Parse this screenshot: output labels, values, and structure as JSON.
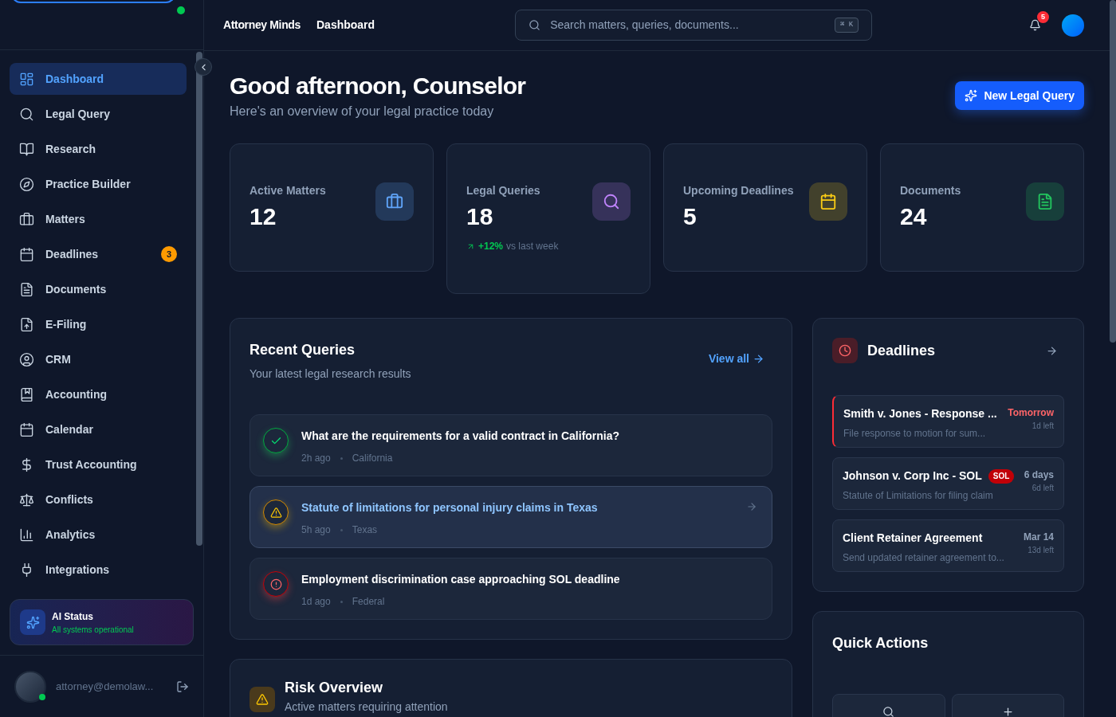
{
  "sidebar": {
    "status_online": true,
    "nav": [
      {
        "label": "Dashboard",
        "selected": true
      },
      {
        "label": "Legal Query",
        "selected": false
      },
      {
        "label": "Research",
        "selected": false
      },
      {
        "label": "Practice Builder",
        "selected": false
      },
      {
        "label": "Matters",
        "selected": false
      },
      {
        "label": "Deadlines",
        "selected": false,
        "badge": "3"
      },
      {
        "label": "Documents",
        "selected": false
      },
      {
        "label": "E-Filing",
        "selected": false
      },
      {
        "label": "CRM",
        "selected": false
      },
      {
        "label": "Accounting",
        "selected": false
      },
      {
        "label": "Calendar",
        "selected": false
      },
      {
        "label": "Trust Accounting",
        "selected": false
      },
      {
        "label": "Conflicts",
        "selected": false
      },
      {
        "label": "Analytics",
        "selected": false
      },
      {
        "label": "Integrations",
        "selected": false
      }
    ],
    "ai_status": {
      "title": "AI Status",
      "text": "All systems operational"
    },
    "user": {
      "email": "attorney@demolaw...",
      "online": true
    }
  },
  "header": {
    "brand": "Attorney Minds",
    "page": "Dashboard",
    "search": {
      "placeholder": "Search matters, queries, documents...",
      "shortcut": "⌘ K"
    },
    "notifications": "5"
  },
  "greeting": {
    "title": "Good afternoon, Counselor",
    "subtitle": "Here's an overview of your legal practice today",
    "button": "New Legal Query"
  },
  "stats": [
    {
      "label": "Active Matters",
      "value": "12",
      "color": "#60a5fa"
    },
    {
      "label": "Legal Queries",
      "value": "18",
      "color": "#c084fc",
      "trend": {
        "value": "+12%",
        "label": "vs last week"
      }
    },
    {
      "label": "Upcoming Deadlines",
      "value": "5",
      "color": "#facc15"
    },
    {
      "label": "Documents",
      "value": "24",
      "color": "#22c55e"
    }
  ],
  "recent_queries": {
    "title": "Recent Queries",
    "subtitle": "Your latest legal research results",
    "link": "View all",
    "items": [
      {
        "kind": "success",
        "title": "What are the requirements for a valid contract in California?",
        "time": "2h ago",
        "place": "California",
        "selected": false
      },
      {
        "kind": "warning",
        "title": "Statute of limitations for personal injury claims in Texas",
        "time": "5h ago",
        "place": "Texas",
        "selected": true
      },
      {
        "kind": "error",
        "title": "Employment discrimination case approaching SOL deadline",
        "time": "1d ago",
        "place": "Federal",
        "selected": false
      }
    ]
  },
  "deadlines": {
    "title": "Deadlines",
    "items": [
      {
        "title": "Smith v. Jones - Response ...",
        "text": "File response to motion for sum...",
        "when": "Tomorrow",
        "left": "1d left",
        "urgent": true
      },
      {
        "title": "Johnson v. Corp Inc - SOL",
        "badge": "SOL",
        "text": "Statute of Limitations for filing claim",
        "when": "6 days",
        "left": "6d left",
        "urgent": false
      },
      {
        "title": "Client Retainer Agreement",
        "text": "Send updated retainer agreement to...",
        "when": "Mar 14",
        "left": "13d left",
        "urgent": false
      }
    ]
  },
  "risk_overview": {
    "title": "Risk Overview",
    "subtitle": "Active matters requiring attention"
  },
  "quick_actions": {
    "title": "Quick Actions"
  }
}
